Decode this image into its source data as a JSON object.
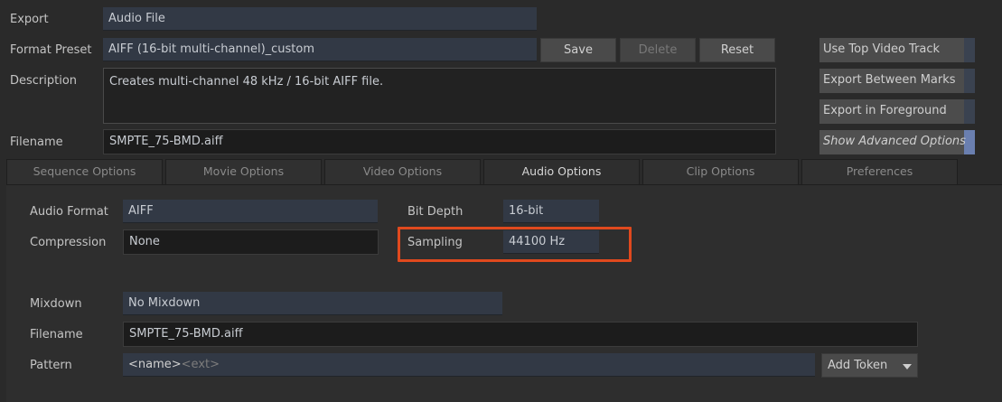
{
  "header": {
    "export_label": "Export",
    "export_value": "Audio File",
    "format_preset_label": "Format Preset",
    "format_preset_value": "AIFF (16-bit multi-channel)_custom",
    "save_label": "Save",
    "delete_label": "Delete",
    "reset_label": "Reset",
    "description_label": "Description",
    "description_value": "Creates multi-channel 48 kHz / 16-bit AIFF file.",
    "filename_label": "Filename",
    "filename_value": "SMPTE_75-BMD.aiff"
  },
  "toggles": {
    "use_top_video_track": "Use Top Video Track",
    "export_between_marks": "Export Between Marks",
    "export_in_foreground": "Export in Foreground",
    "show_advanced_options": "Show Advanced Options"
  },
  "tabs": [
    {
      "label": "Sequence Options",
      "active": false
    },
    {
      "label": "Movie Options",
      "active": false
    },
    {
      "label": "Video Options",
      "active": false
    },
    {
      "label": "Audio Options",
      "active": true
    },
    {
      "label": "Clip Options",
      "active": false
    },
    {
      "label": "Preferences",
      "active": false
    }
  ],
  "audio_options": {
    "audio_format_label": "Audio Format",
    "audio_format_value": "AIFF",
    "compression_label": "Compression",
    "compression_value": "None",
    "bit_depth_label": "Bit Depth",
    "bit_depth_value": "16-bit",
    "sampling_label": "Sampling",
    "sampling_value": "44100 Hz",
    "mixdown_label": "Mixdown",
    "mixdown_value": "No Mixdown",
    "filename_label": "Filename",
    "filename_value": "SMPTE_75-BMD.aiff",
    "pattern_label": "Pattern",
    "pattern_token_name": "<name>",
    "pattern_token_ext": "<ext>",
    "add_token_label": "Add Token"
  },
  "colors": {
    "highlight": "#e0491e",
    "toggle_on_indicator": "#6a7fb0"
  }
}
